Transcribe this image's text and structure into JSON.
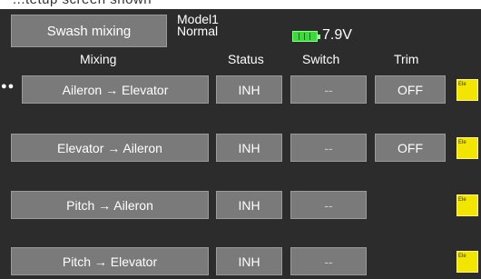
{
  "top_text": "...tetup screen shown",
  "header": {
    "title": "Swash mixing",
    "model_name": "Model1",
    "condition": "Normal",
    "voltage": "7.9V",
    "battery_icon": "battery-icon"
  },
  "columns": {
    "mixing": "Mixing",
    "status": "Status",
    "switch": "Switch",
    "trim": "Trim"
  },
  "rows": [
    {
      "label": "Aileron → Elevator",
      "status": "INH",
      "switch": "--",
      "trim": "OFF",
      "icon_text": "Ele"
    },
    {
      "label": "Elevator → Aileron",
      "status": "INH",
      "switch": "--",
      "trim": "OFF",
      "icon_text": "Ele"
    },
    {
      "label": "Pitch → Aileron",
      "status": "INH",
      "switch": "--",
      "trim": "",
      "icon_text": "Ele"
    },
    {
      "label": "Pitch → Elevator",
      "status": "INH",
      "switch": "--",
      "trim": "",
      "icon_text": "Ele"
    }
  ],
  "colors": {
    "background": "#2c2c2c",
    "button": "#7a7a7a",
    "battery": "#3fd93f",
    "setup_icon": "#f2e600"
  }
}
